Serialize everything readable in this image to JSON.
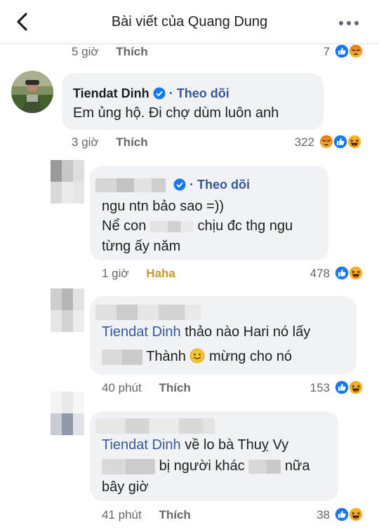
{
  "header": {
    "title": "Bài viết của Quang Dung",
    "back_icon": "chevron-left-icon",
    "more_icon": "more-horizontal-icon"
  },
  "comments": [
    {
      "time": "5 giờ",
      "action": "Thích",
      "reaction_count": "7",
      "reactions": [
        "like",
        "angry"
      ]
    },
    {
      "author": "Tiendat Dinh",
      "follow_label": "Theo dõi",
      "text": "Em ủng hộ. Đi chợ dùm luôn anh",
      "time": "3 giờ",
      "action": "Thích",
      "reaction_count": "322",
      "reactions": [
        "angry",
        "like",
        "haha"
      ]
    },
    {
      "follow_label": "Theo dõi",
      "lines": [
        "ngu ntn bảo sao =))",
        "Nể con",
        "chịu đc thg ngu",
        "từng ấy năm"
      ],
      "time": "1 giờ",
      "action": "Haha",
      "reaction_count": "478",
      "reactions": [
        "like",
        "haha"
      ]
    },
    {
      "mention": "Tiendat Dinh",
      "text_1": "thảo nào Hari nó lấy",
      "text_2": "Thành",
      "text_3": "mừng cho nó",
      "time": "40 phút",
      "action": "Thích",
      "reaction_count": "153",
      "reactions": [
        "like",
        "haha"
      ]
    },
    {
      "mention": "Tiendat Dinh",
      "text_1": "về lo bà Thuỵ Vy",
      "text_2": "bị người khác",
      "text_3": "nữa",
      "text_4": "bây giờ",
      "time": "41 phút",
      "action": "Thích",
      "reaction_count": "38",
      "reactions": [
        "like",
        "haha"
      ]
    }
  ],
  "colors": {
    "facebook_blue": "#1877f2",
    "link_blue": "#385898",
    "bubble_gray": "#f0f2f5",
    "meta_gray": "#65676b",
    "haha_yellow": "#f7b125",
    "angry_orange": "#e9710f"
  }
}
